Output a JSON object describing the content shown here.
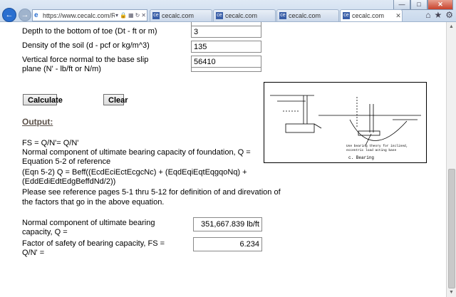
{
  "browser": {
    "address": "https://www.cecalc.com/Retain",
    "tabs": [
      {
        "label": "cecalc.com"
      },
      {
        "label": "cecalc.com"
      },
      {
        "label": "cecalc.com"
      },
      {
        "label": "cecalc.com"
      }
    ]
  },
  "inputs": {
    "toe_depth": {
      "label": "Depth to the bottom of toe (Dt - ft or m)",
      "value": "3"
    },
    "soil_density": {
      "label": "Density of the soil (d - pcf or kg/m^3)",
      "value": "135"
    },
    "vertical_force": {
      "label_line1": "Vertical force normal to the base slip",
      "label_line2": "plane (N' - lb/ft or N/m)",
      "value": "56410"
    }
  },
  "buttons": {
    "calculate": "Calculate",
    "clear": "Clear"
  },
  "output": {
    "heading": "Output:",
    "lines": [
      "FS = Q/N'= Q/N'",
      "Normal component of ultimate bearing capacity of foundation, Q =",
      "Equation 5-2 of reference",
      "(Eqn 5-2) Q = Beff((EcdEciEctEcgcNc) + (EqdEqiEqtEqgqoNq) +",
      "(EddEdiEdtEdgBeffdNd/2))",
      "Please see reference pages 5-1 thru 5-12 for definition of and direvation of",
      "the factors that go in the above equation."
    ],
    "q_label_line1": "Normal component of ultimate bearing",
    "q_label_line2": "capacity, Q =",
    "q_value": "351,667.839 lb/ft",
    "fs_label_line1": "Factor of safety of bearing capacity, FS =",
    "fs_label_line2": "Q/N' =",
    "fs_value": "6.234"
  },
  "figure": {
    "note_line1": "Use bearing theory for inclined,",
    "note_line2": "eccentric load acting base",
    "caption": "c.  Bearing"
  }
}
